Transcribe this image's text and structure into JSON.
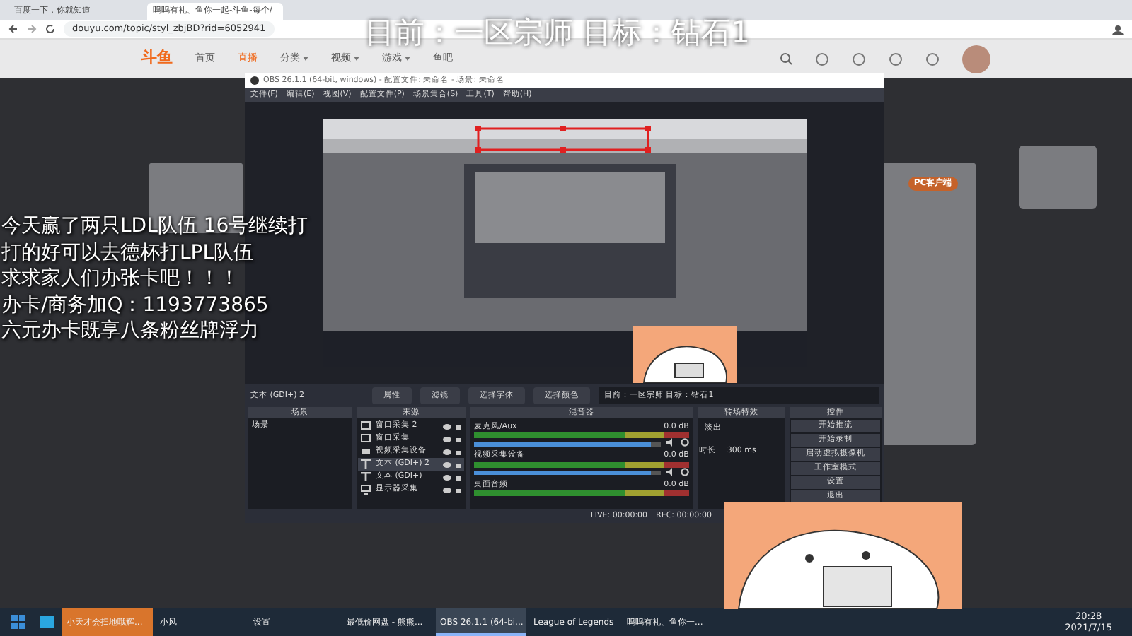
{
  "browser": {
    "tabs": [
      {
        "label": "百度一下，你就知道",
        "selected": false
      },
      {
        "label": "呜呜有礼、鱼你一起-斗鱼-每个/",
        "selected": true
      }
    ],
    "url": "douyu.com/topic/styl_zbjBD?rid=6052941"
  },
  "stream_overlay": {
    "top_text": "目前：一区宗师 目标：钻石1",
    "left_lines": [
      "今天赢了两只LDL队伍 16号继续打",
      "打的好可以去德杯打LPL队伍",
      "求求家人们办张卡吧！！！",
      "办卡/商务加Q：1193773865",
      "六元办卡既享八条粉丝牌浮力"
    ]
  },
  "site": {
    "logo": "斗鱼",
    "nav": [
      {
        "label": "首页",
        "selected": false,
        "dropdown": false
      },
      {
        "label": "直播",
        "selected": true,
        "dropdown": false
      },
      {
        "label": "分类",
        "selected": false,
        "dropdown": true
      },
      {
        "label": "视频",
        "selected": false,
        "dropdown": true
      },
      {
        "label": "游戏",
        "selected": false,
        "dropdown": true
      },
      {
        "label": "鱼吧",
        "selected": false,
        "dropdown": false
      }
    ],
    "client_button": "PC客户端"
  },
  "obs": {
    "title": "OBS 26.1.1 (64-bit, windows) - 配置文件: 未命名 - 场景: 未命名",
    "menu": [
      "文件(F)",
      "编辑(E)",
      "视图(V)",
      "配置文件(P)",
      "场景集合(S)",
      "工具(T)",
      "帮助(H)"
    ],
    "source_label": "文本 (GDI+) 2",
    "toolbar": [
      "属性",
      "滤镜",
      "选择字体",
      "选择颜色"
    ],
    "text_value": "目前：一区宗师 目标：钻石1",
    "scenes": {
      "title": "场景",
      "items": [
        {
          "label": "场景",
          "selected": false
        }
      ]
    },
    "sources": {
      "title": "来源",
      "items": [
        {
          "label": "窗口采集 2",
          "kind": "window",
          "selected": false
        },
        {
          "label": "窗口采集",
          "kind": "window",
          "selected": false
        },
        {
          "label": "视频采集设备",
          "kind": "camera",
          "selected": false
        },
        {
          "label": "文本 (GDI+) 2",
          "kind": "text",
          "selected": true
        },
        {
          "label": "文本 (GDI+)",
          "kind": "text",
          "selected": false
        },
        {
          "label": "显示器采集",
          "kind": "monitor",
          "selected": false
        }
      ]
    },
    "mixer": {
      "title": "混音器",
      "channels": [
        {
          "name": "麦克风/Aux",
          "reading": "0.0 dB",
          "level": 0.95
        },
        {
          "name": "视频采集设备",
          "reading": "0.0 dB",
          "level": 0.95
        },
        {
          "name": "桌面音频",
          "reading": "0.0 dB"
        }
      ]
    },
    "transitions": {
      "title": "转场特效",
      "select": "淡出",
      "duration_label": "时长",
      "duration": "300 ms"
    },
    "controls": {
      "title": "控件",
      "buttons": [
        "开始推流",
        "开始录制",
        "启动虚拟摄像机",
        "工作室模式",
        "设置",
        "退出"
      ]
    },
    "status": {
      "live": "LIVE: 00:00:00",
      "rec": "REC: 00:00:00"
    }
  },
  "taskbar": {
    "items": [
      {
        "label": "小天才会扫地哦辉...",
        "selected": false,
        "flashing": true
      },
      {
        "label": "小风",
        "selected": false,
        "flashing": false
      },
      {
        "label": "设置",
        "selected": false,
        "flashing": false
      },
      {
        "label": "最低价网盘 - 熊熊...",
        "selected": false,
        "flashing": false
      },
      {
        "label": "OBS 26.1.1 (64-bi...",
        "selected": true,
        "flashing": false
      },
      {
        "label": "League of Legends",
        "selected": false,
        "flashing": false
      },
      {
        "label": "呜呜有礼、鱼你一...",
        "selected": false,
        "flashing": false
      }
    ],
    "time": "20:28",
    "date": "2021/7/15"
  }
}
